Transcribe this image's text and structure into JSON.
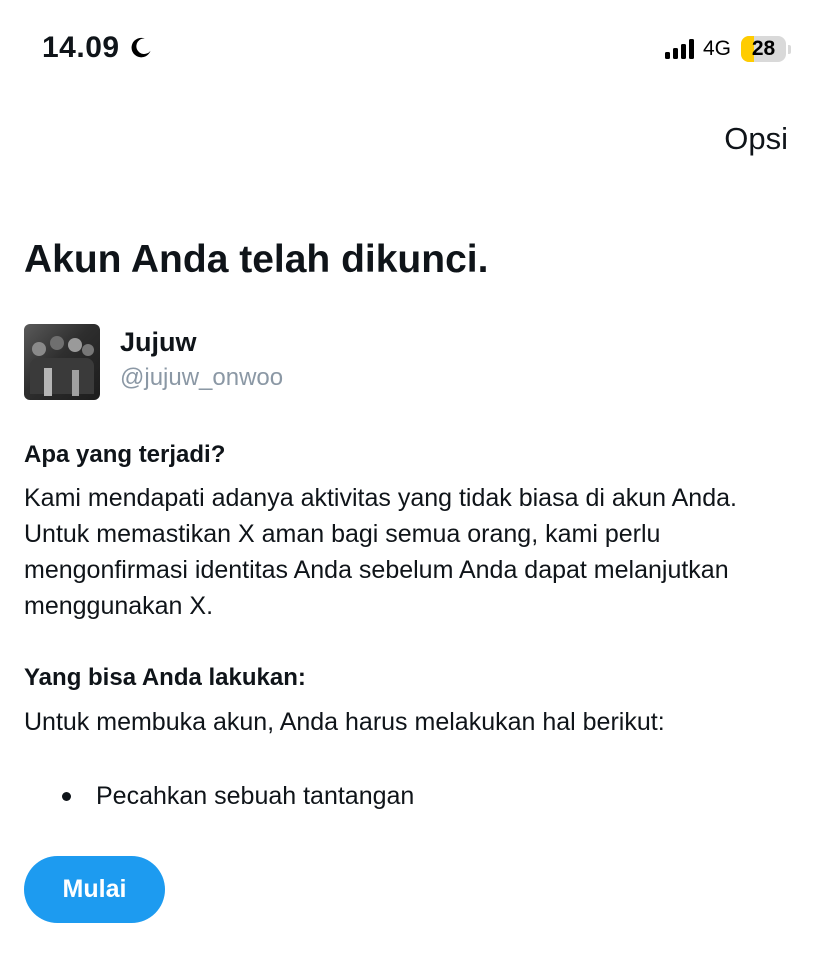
{
  "status_bar": {
    "time": "14.09",
    "network": "4G",
    "battery": "28",
    "battery_level": 0.28,
    "battery_color": "#ffcc00",
    "icons": [
      "moon-icon",
      "signal-icon",
      "battery-icon"
    ]
  },
  "header": {
    "options_label": "Opsi"
  },
  "main": {
    "title": "Akun Anda telah dikunci.",
    "profile": {
      "display_name": "Jujuw",
      "username": "@jujuw_onwoo"
    },
    "what_happened": {
      "heading": "Apa yang terjadi?",
      "text": "Kami mendapati adanya aktivitas yang tidak biasa di akun Anda. Untuk memastikan X aman bagi semua orang, kami perlu mengonfirmasi identitas Anda sebelum Anda dapat melanjutkan menggunakan X."
    },
    "what_you_can_do": {
      "heading": "Yang bisa Anda lakukan:",
      "text": "Untuk membuka akun, Anda harus melakukan hal berikut:",
      "items": [
        "Pecahkan sebuah tantangan"
      ]
    },
    "start_button_label": "Mulai"
  },
  "colors": {
    "accent": "#1d9bf0",
    "text_primary": "#0f1419",
    "text_secondary": "#8b98a5"
  }
}
